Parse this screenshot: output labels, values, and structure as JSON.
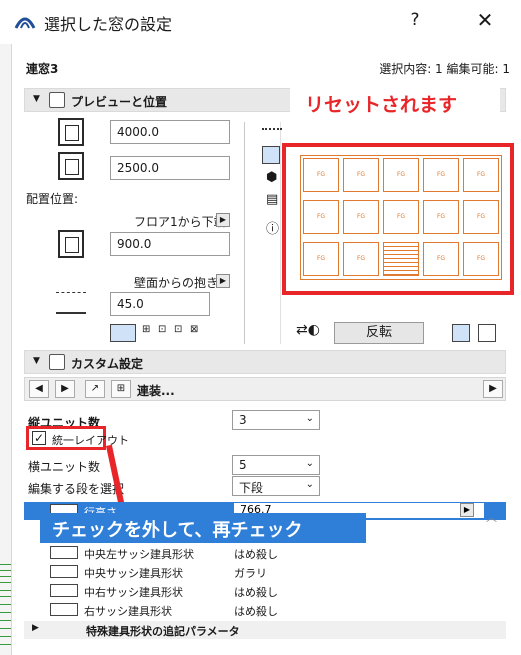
{
  "titlebar": {
    "title": "選択した窓の設定",
    "help_label": "?",
    "close_label": "✕",
    "icon_name": "archicad-logo-icon"
  },
  "header": {
    "panel_name": "連窓3",
    "selection_info": "選択内容: 1 編集可能: 1"
  },
  "preview_section": {
    "title": "プレビューと位置",
    "width_value": "4000.0",
    "height_value": "2500.0",
    "placement_label": "配置位置:",
    "floor_ref_label": "フロア1から下端",
    "sill_value": "900.0",
    "reveal_label": "壁面からの抱き",
    "reveal_value": "45.0",
    "flip_label": "反転",
    "cell_label": "FG"
  },
  "annotations": {
    "reset_note": "リセットされます",
    "check_note": "チェックを外して、再チェック",
    "accent_color": "#e8262a"
  },
  "custom_section": {
    "title": "カスタム設定",
    "dropdown_label": "連装..."
  },
  "params": {
    "v_units_label": "縦ユニット数",
    "v_units_value": "3",
    "uniform_layout_label": "統一レイアウト",
    "uniform_layout_checked": true,
    "h_units_label": "横ユニット数",
    "h_units_value": "5",
    "edit_row_label": "編集する段を選択",
    "edit_row_value": "下段"
  },
  "table": {
    "rows": [
      {
        "label": "行高さ",
        "value": "766.7",
        "selected": true
      },
      {
        "label": "中央左サッシ建具形状",
        "value": "はめ殺し"
      },
      {
        "label": "中央サッシ建具形状",
        "value": "ガラリ"
      },
      {
        "label": "中右サッシ建具形状",
        "value": "はめ殺し"
      },
      {
        "label": "右サッシ建具形状",
        "value": "はめ殺し"
      }
    ],
    "footer_label": "特殊建具形状の追記パラメータ"
  }
}
